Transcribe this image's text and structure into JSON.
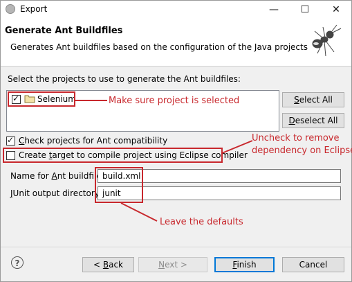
{
  "window": {
    "title": "Export",
    "minimize_glyph": "—",
    "maximize_glyph": "☐",
    "close_glyph": "✕"
  },
  "header": {
    "title": "Generate Ant Buildfiles",
    "description": "Generates Ant buildfiles based on the configuration of the Java projects",
    "image_icon": "ant-icon"
  },
  "projects": {
    "label": "Select the projects to use to generate the Ant buildfiles:",
    "items": [
      {
        "name": "Selenium",
        "checked": true,
        "icon": "folder-icon"
      }
    ],
    "select_all": "Select All",
    "deselect_all": "Deselect All"
  },
  "options": {
    "check_compat": {
      "label": "Check projects for Ant compatibility",
      "checked": true
    },
    "create_target": {
      "label": "Create target to compile project using Eclipse compiler",
      "checked": false
    }
  },
  "fields": {
    "buildfile": {
      "label": "Name for Ant buildfile:",
      "value": "build.xml"
    },
    "junit": {
      "label": "JUnit output directory:",
      "value": "junit"
    }
  },
  "annotations": {
    "project_note": "Make sure project is selected",
    "uncheck_note_line1": "Uncheck to remove",
    "uncheck_note_line2": "dependency on Eclipse",
    "defaults_note": "Leave the defaults"
  },
  "footer": {
    "help": "?",
    "back": "< Back",
    "next": "Next >",
    "finish": "Finish",
    "cancel": "Cancel"
  },
  "colors": {
    "annotation": "#c8282d",
    "focus": "#0078d7"
  }
}
